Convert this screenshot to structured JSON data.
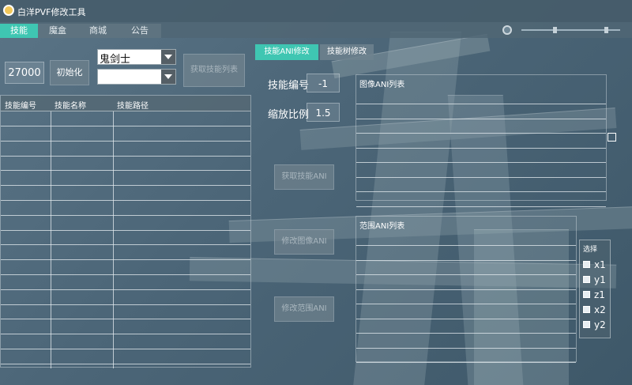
{
  "app": {
    "title": "白洋PVF修改工具"
  },
  "menu": {
    "tabs": [
      "技能",
      "魔盒",
      "商城",
      "公告"
    ],
    "active": 0
  },
  "left": {
    "code_value": "27000",
    "init_button": "初始化",
    "job_value": "鬼剑士",
    "subjob_value": "",
    "get_list_button": "获取技能列表",
    "table": {
      "headers": [
        "技能编号",
        "技能名称",
        "技能路径"
      ],
      "rows": 17
    }
  },
  "right": {
    "tabs": [
      "技能ANI修改",
      "技能树修改"
    ],
    "active_tab": 0,
    "skill_id_label": "技能编号",
    "skill_id_value": "-1",
    "scale_label": "缩放比例",
    "scale_value": "1.5",
    "get_ani_button": "获取技能ANI",
    "modify_image_button": "修改图像ANI",
    "modify_range_button": "修改范围ANI",
    "image_list_title": "图像ANI列表",
    "range_list_title": "范围ANI列表",
    "select_panel": {
      "title": "选择",
      "options": [
        "x1",
        "y1",
        "z1",
        "x2",
        "y2"
      ]
    }
  },
  "colors": {
    "accent": "#3fc6b2"
  }
}
